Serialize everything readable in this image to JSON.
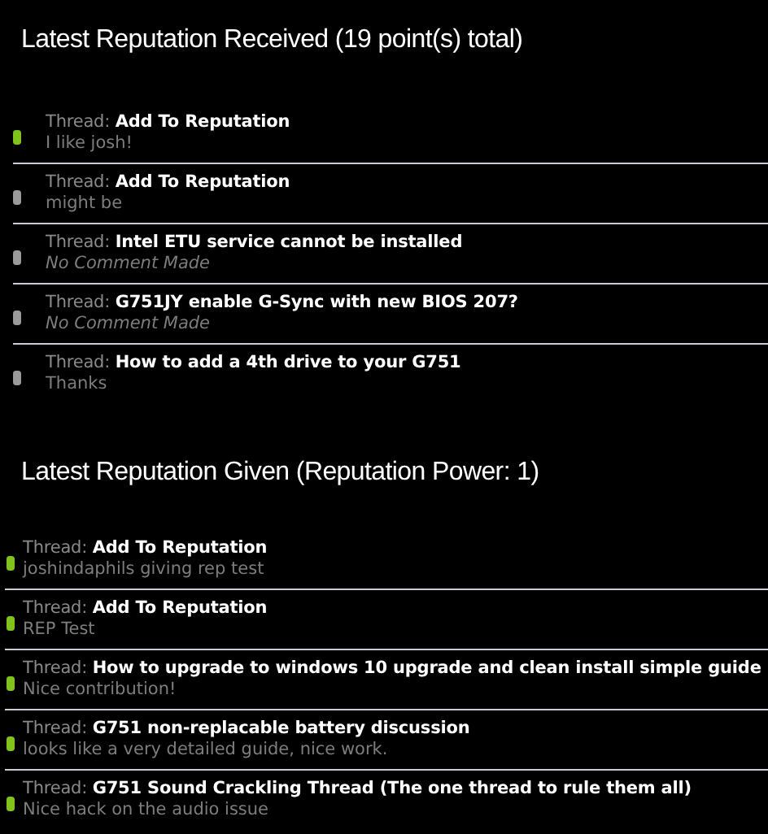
{
  "sections": [
    {
      "title": "Latest Reputation Received (19 point(s) total)",
      "kind": "indented",
      "items": [
        {
          "prefix": "Thread:",
          "thread": "Add To Reputation",
          "comment": "I like josh!",
          "kind": "text",
          "color": "#7fc31c"
        },
        {
          "prefix": "Thread:",
          "thread": "Add To Reputation",
          "comment": "might be",
          "kind": "text",
          "color": "#9a9a9a"
        },
        {
          "prefix": "Thread:",
          "thread": "Intel ETU service cannot be installed",
          "comment": "No Comment Made",
          "kind": "none",
          "color": "#9a9a9a"
        },
        {
          "prefix": "Thread:",
          "thread": "G751JY enable G-Sync with new BIOS 207?",
          "comment": "No Comment Made",
          "kind": "none",
          "color": "#9a9a9a"
        },
        {
          "prefix": "Thread:",
          "thread": "How to add a 4th drive to your G751",
          "comment": "Thanks",
          "kind": "text",
          "color": "#9a9a9a"
        }
      ]
    },
    {
      "title": "Latest Reputation Given (Reputation Power: 1)",
      "kind": "compact",
      "items": [
        {
          "prefix": "Thread:",
          "thread": "Add To Reputation",
          "comment": "joshindaphils giving rep test",
          "kind": "text",
          "color": "#7fc31c"
        },
        {
          "prefix": "Thread:",
          "thread": "Add To Reputation",
          "comment": "REP Test",
          "kind": "text",
          "color": "#7fc31c"
        },
        {
          "prefix": "Thread:",
          "thread": "How to upgrade to windows 10 upgrade and clean install simple guide",
          "comment": "Nice contribution!",
          "kind": "text",
          "color": "#7fc31c"
        },
        {
          "prefix": "Thread:",
          "thread": "G751 non-replacable battery discussion",
          "comment": "looks like a very detailed guide, nice work.",
          "kind": "text",
          "color": "#7fc31c"
        },
        {
          "prefix": "Thread:",
          "thread": "G751 Sound Crackling Thread (The one thread to rule them all)",
          "comment": "Nice hack on the audio issue",
          "kind": "text",
          "color": "#7fc31c"
        }
      ]
    }
  ]
}
